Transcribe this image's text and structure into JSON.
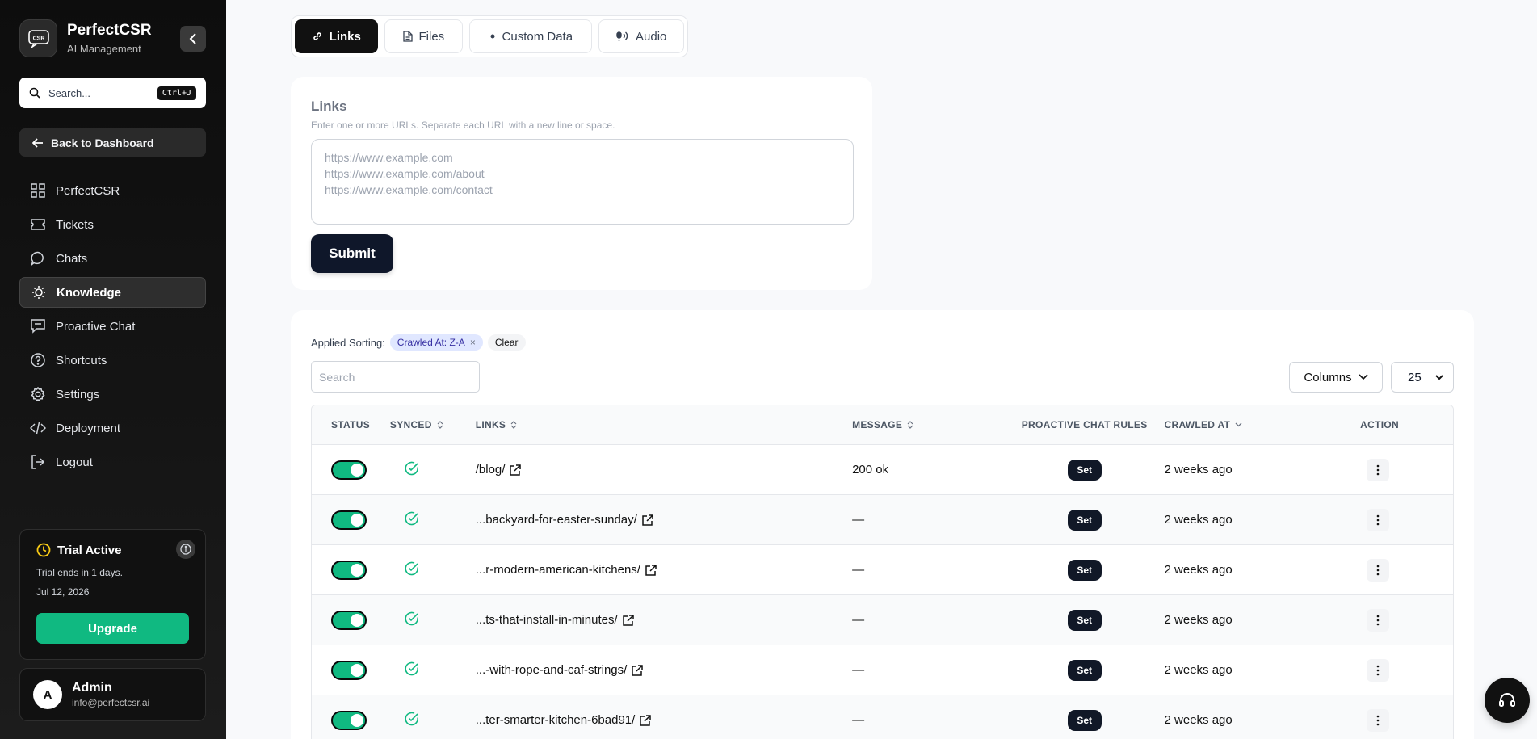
{
  "brand": {
    "name": "PerfectCSR",
    "subtitle": "AI Management",
    "logo_text": "CSR"
  },
  "search": {
    "placeholder": "Search...",
    "shortcut": "Ctrl+J"
  },
  "back_button": "Back to Dashboard",
  "nav": [
    {
      "label": "PerfectCSR",
      "icon": "grid-icon",
      "active": false
    },
    {
      "label": "Tickets",
      "icon": "ticket-icon",
      "active": false
    },
    {
      "label": "Chats",
      "icon": "chat-bubble-icon",
      "active": false
    },
    {
      "label": "Knowledge",
      "icon": "lightbulb-icon",
      "active": true
    },
    {
      "label": "Proactive Chat",
      "icon": "message-square-icon",
      "active": false
    },
    {
      "label": "Shortcuts",
      "icon": "help-circle-icon",
      "active": false
    },
    {
      "label": "Settings",
      "icon": "gear-icon",
      "active": false
    },
    {
      "label": "Deployment",
      "icon": "code-icon",
      "active": false
    },
    {
      "label": "Logout",
      "icon": "logout-icon",
      "active": false
    }
  ],
  "trial": {
    "title": "Trial Active",
    "ends": "Trial ends in 1 days.",
    "date": "Jul 12, 2026",
    "upgrade": "Upgrade"
  },
  "user": {
    "initial": "A",
    "name": "Admin",
    "email": "info@perfectcsr.ai"
  },
  "tabs": [
    {
      "label": "Links",
      "active": true
    },
    {
      "label": "Files",
      "active": false
    },
    {
      "label": "Custom Data",
      "active": false
    },
    {
      "label": "Audio",
      "active": false
    }
  ],
  "links_form": {
    "title": "Links",
    "hint": "Enter one or more URLs. Separate each URL with a new line or space.",
    "placeholder": "https://www.example.com\nhttps://www.example.com/about\nhttps://www.example.com/contact",
    "submit": "Submit"
  },
  "table": {
    "applied_sorting_label": "Applied Sorting:",
    "sort_chip": "Crawled At: Z-A",
    "clear": "Clear",
    "search_placeholder": "Search",
    "columns_button": "Columns",
    "per_page": "25",
    "headers": {
      "status": "STATUS",
      "synced": "SYNCED",
      "links": "LINKS",
      "message": "MESSAGE",
      "rules": "PROACTIVE CHAT RULES",
      "crawled": "CRAWLED AT",
      "action": "ACTION"
    },
    "rows": [
      {
        "link": "/blog/",
        "message": "200 ok",
        "rules": "Set",
        "crawled": "2 weeks ago"
      },
      {
        "link": "...backyard-for-easter-sunday/",
        "message": "—",
        "rules": "Set",
        "crawled": "2 weeks ago"
      },
      {
        "link": "...r-modern-american-kitchens/",
        "message": "—",
        "rules": "Set",
        "crawled": "2 weeks ago"
      },
      {
        "link": "...ts-that-install-in-minutes/",
        "message": "—",
        "rules": "Set",
        "crawled": "2 weeks ago"
      },
      {
        "link": "...-with-rope-and-caf-strings/",
        "message": "—",
        "rules": "Set",
        "crawled": "2 weeks ago"
      },
      {
        "link": "...ter-smarter-kitchen-6bad91/",
        "message": "—",
        "rules": "Set",
        "crawled": "2 weeks ago"
      }
    ]
  }
}
